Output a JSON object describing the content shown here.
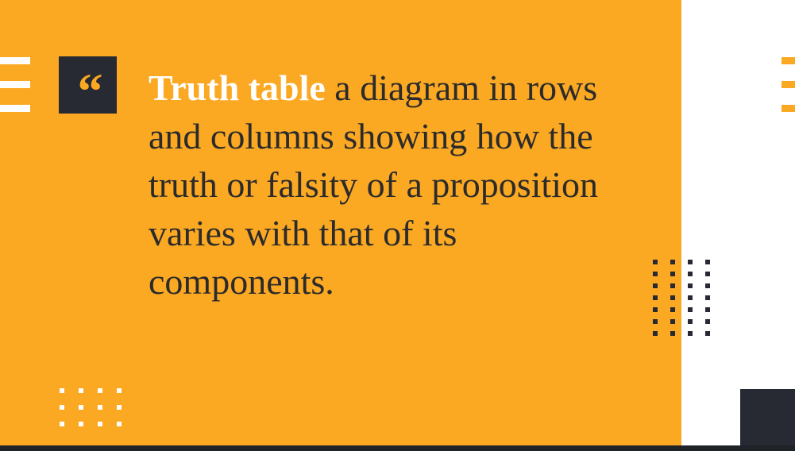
{
  "slide": {
    "quote_mark": "“",
    "term": "Truth table",
    "definition": " a diagram in rows and columns showing how the truth or falsity of a proposition varies with that of its components."
  },
  "colors": {
    "accent": "#fba823",
    "dark": "#272a33",
    "text": "#2b2b2b",
    "background": "#ffffff"
  },
  "decorations": {
    "left_bars": 3,
    "right_bars": 3,
    "bottom_left_dots": {
      "rows": 3,
      "cols": 4
    },
    "right_dots": {
      "rows": 7,
      "cols": 4
    }
  }
}
